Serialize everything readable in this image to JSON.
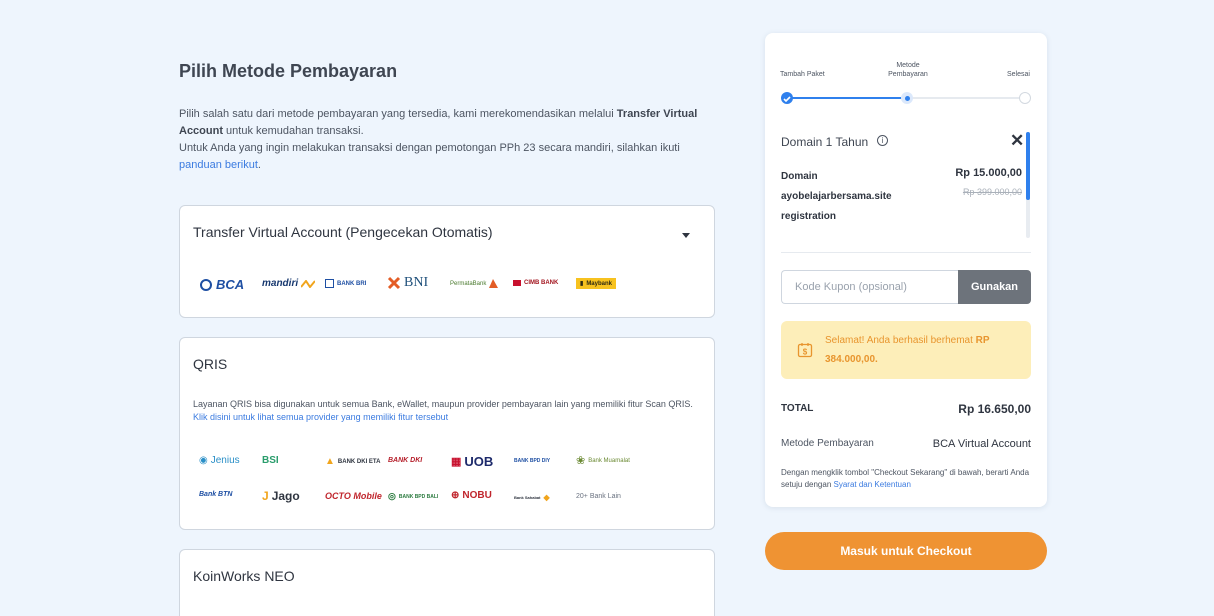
{
  "page": {
    "title": "Pilih Metode Pembayaran",
    "intro_p1_a": "Pilih salah satu dari metode pembayaran yang tersedia, kami merekomendasikan melalui ",
    "intro_p1_bold": "Transfer Virtual Account",
    "intro_p1_b": " untuk kemudahan transaksi.",
    "intro_p2_a": "Untuk Anda yang ingin melakukan transaksi dengan pemotongan PPh 23 secara mandiri, silahkan ikuti ",
    "intro_p2_link": "panduan berikut",
    "intro_p2_b": "."
  },
  "va_section": {
    "title": "Transfer Virtual Account (Pengecekan Otomatis)",
    "banks": [
      {
        "name": "BCA",
        "color": "#1e4fa3",
        "icon": "bca-icon"
      },
      {
        "name": "mandiri",
        "color": "#17386f",
        "icon": "mandiri-icon"
      },
      {
        "name": "BANK BRI",
        "color": "#1e4fa3",
        "icon": "bri-icon"
      },
      {
        "name": "BNI",
        "color": "#1e4f7a",
        "icon": "bni-icon"
      },
      {
        "name": "PermataBank",
        "color": "#4a7a2e",
        "icon": "permata-icon"
      },
      {
        "name": "CIMB BANK",
        "color": "#a3151f",
        "icon": "cimb-icon"
      },
      {
        "name": "Maybank",
        "color": "#2f2a12",
        "icon": "maybank-icon"
      }
    ]
  },
  "qris_section": {
    "title": "QRIS",
    "desc": "Layanan QRIS bisa digunakan untuk semua Bank, eWallet, maupun provider pembayaran lain yang memiliki fitur Scan QRIS. ",
    "link": "Klik disini untuk lihat semua provider yang memiliki fitur tersebut",
    "providers_row1": [
      {
        "name": "Jenius",
        "color": "#2a8fc7"
      },
      {
        "name": "BSI",
        "color": "#2a9d6c"
      },
      {
        "name": "BANK DKI ETA",
        "color": "#2f3540"
      },
      {
        "name": "BANK DKI",
        "color": "#b51e2a"
      },
      {
        "name": "UOB",
        "color": "#1d2a6b"
      },
      {
        "name": "BANK BPD DIY",
        "color": "#1e4fa3"
      },
      {
        "name": "Bank Muamalat",
        "color": "#6b8a33"
      }
    ],
    "providers_row2": [
      {
        "name": "Bank BTN",
        "color": "#1e4fa3"
      },
      {
        "name": "Jago",
        "color": "#2f3540"
      },
      {
        "name": "OCTO Mobile",
        "color": "#c0262d"
      },
      {
        "name": "BANK BPD BALI",
        "color": "#2a7a3e"
      },
      {
        "name": "NOBU",
        "color": "#c0262d"
      },
      {
        "name": "Bank Sahabat",
        "color": "#2f3540"
      },
      {
        "name": "20+ Bank Lain",
        "color": "#6a7280"
      }
    ]
  },
  "koinworks_section": {
    "title": "KoinWorks NEO"
  },
  "sidebar": {
    "steps": [
      "Tambah Paket",
      "Metode Pembayaran",
      "Selesai"
    ],
    "product_name": "Domain 1 Tahun",
    "item_label": "Domain ayobelajarbersama.site registration",
    "price": "Rp 15.000,00",
    "price_old": "Rp 399.000,00",
    "coupon_placeholder": "Kode Kupon (opsional)",
    "coupon_button": "Gunakan",
    "savings_text": "Selamat! Anda berhasil berhemat ",
    "savings_amount": "RP 384.000,00.",
    "total_label": "TOTAL",
    "total_value": "Rp 16.650,00",
    "method_label": "Metode Pembayaran",
    "method_value": "BCA Virtual Account",
    "terms_text": "Dengan mengklik tombol \"Checkout Sekarang\" di bawah, berarti Anda setuju dengan ",
    "terms_link": "Syarat dan Ketentuan",
    "accent": "#2f80ed"
  },
  "checkout_button": "Masuk untuk Checkout"
}
